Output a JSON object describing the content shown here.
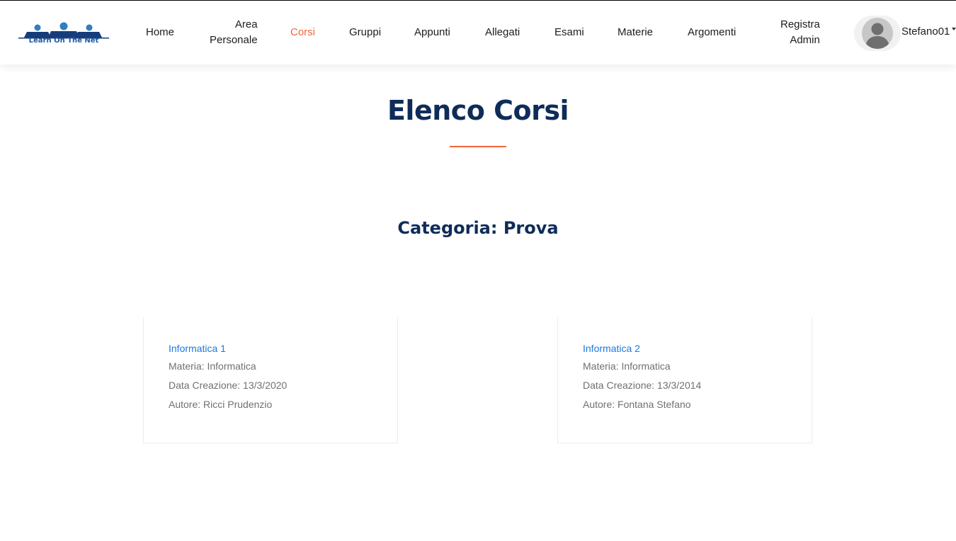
{
  "brand": {
    "logo_text": "Learn On The Net"
  },
  "nav": {
    "home": "Home",
    "area_line1": "Area",
    "area_line2": "Personale",
    "corsi": "Corsi",
    "gruppi": "Gruppi",
    "appunti": "Appunti",
    "allegati": "Allegati",
    "esami": "Esami",
    "materie": "Materie",
    "argomenti": "Argomenti",
    "registra_line1": "Registra",
    "registra_line2": "Admin"
  },
  "user": {
    "name": "Stefano01"
  },
  "page": {
    "title": "Elenco Corsi",
    "category": "Categoria: Prova"
  },
  "courses": [
    {
      "name": "Informatica 1",
      "materia": "Materia: Informatica",
      "data": "Data Creazione: 13/3/2020",
      "autore": "Autore: Ricci Prudenzio"
    },
    {
      "name": "Informatica 2",
      "materia": "Materia: Informatica",
      "data": "Data Creazione: 13/3/2014",
      "autore": "Autore: Fontana Stefano"
    }
  ],
  "colors": {
    "accent": "#f26639",
    "title": "#0f2c59",
    "link": "#1b7ae0",
    "meta": "#707070"
  }
}
